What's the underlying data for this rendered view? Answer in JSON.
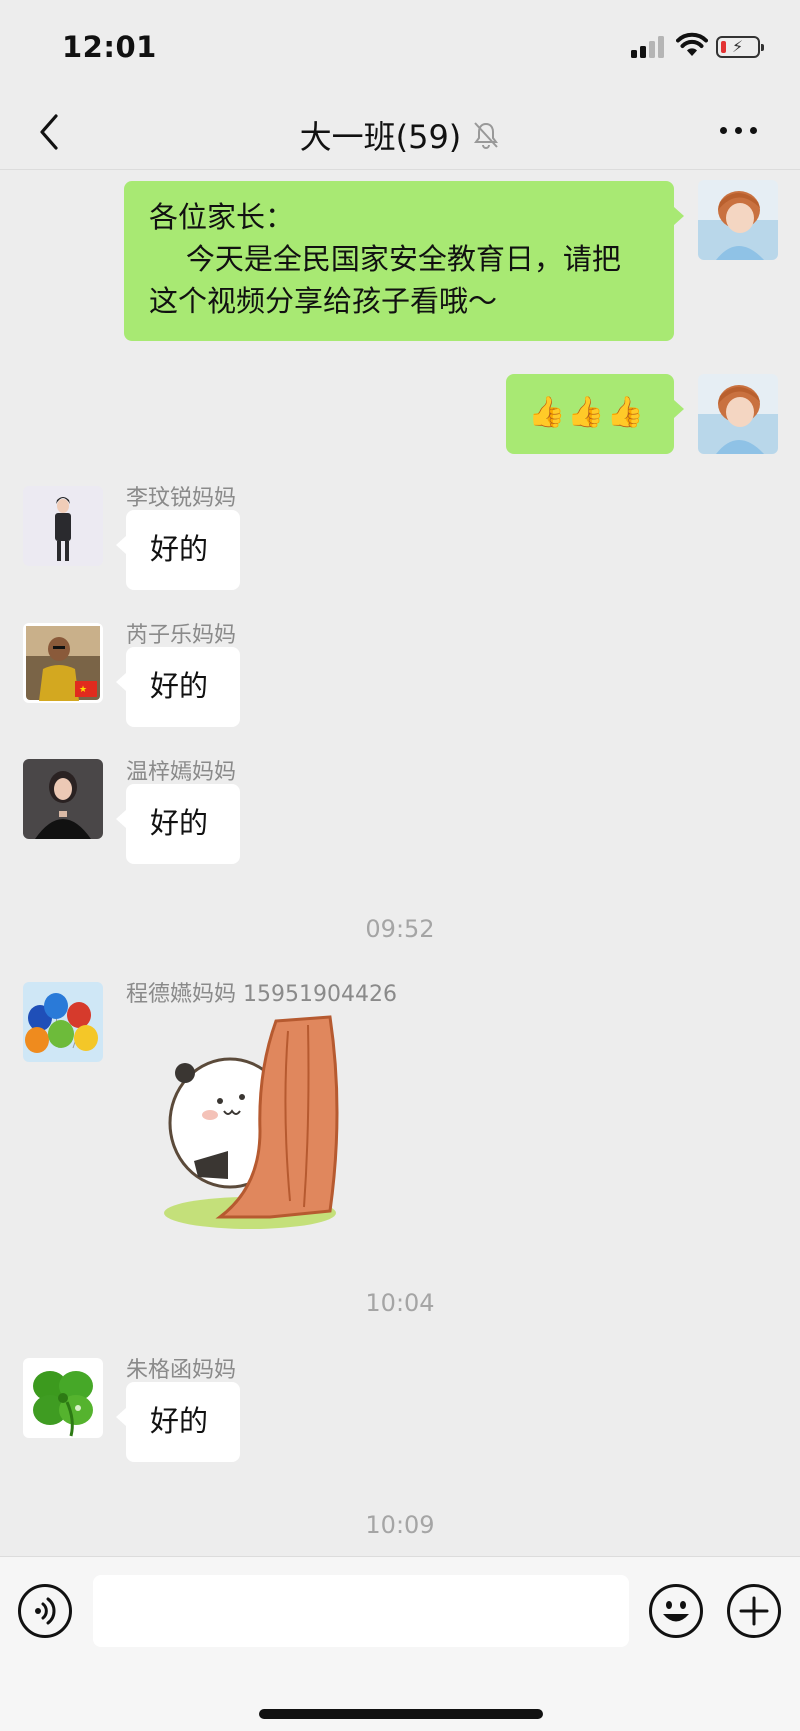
{
  "status_bar": {
    "time": "12:01",
    "battery_level_fraction": 0.15,
    "battery_color": "#e33333"
  },
  "header": {
    "title": "大一班(59)",
    "icons": [
      "back-chevron-icon",
      "mute-bell-icon",
      "more-icon"
    ]
  },
  "colors": {
    "outgoing_bubble": "#a8e973",
    "incoming_bubble": "#ffffff",
    "background": "#ededed"
  },
  "messages": [
    {
      "side": "right",
      "type": "text",
      "text": "各位家长：\n    今天是全民国家安全教育日，请把这个视频分享给孩子看哦～"
    },
    {
      "side": "right",
      "type": "emoji",
      "text": "👍👍👍"
    },
    {
      "side": "left",
      "sender": "李玟锐妈妈",
      "type": "text",
      "text": "好的"
    },
    {
      "side": "left",
      "sender": "芮子乐妈妈",
      "type": "text",
      "text": "好的"
    },
    {
      "side": "left",
      "sender": "温梓嫣妈妈",
      "type": "text",
      "text": "好的"
    },
    {
      "type": "timestamp",
      "text": "09:52"
    },
    {
      "side": "left",
      "sender": "程德嬿妈妈 15951904426",
      "type": "sticker",
      "sticker": "panda-peeking-behind-tree"
    },
    {
      "type": "timestamp",
      "text": "10:04"
    },
    {
      "side": "left",
      "sender": "朱格函妈妈",
      "type": "text",
      "text": "好的"
    },
    {
      "type": "timestamp",
      "text": "10:09"
    }
  ],
  "input_bar": {
    "icons": [
      "voice-icon",
      "emoji-icon",
      "add-icon"
    ],
    "value": ""
  }
}
